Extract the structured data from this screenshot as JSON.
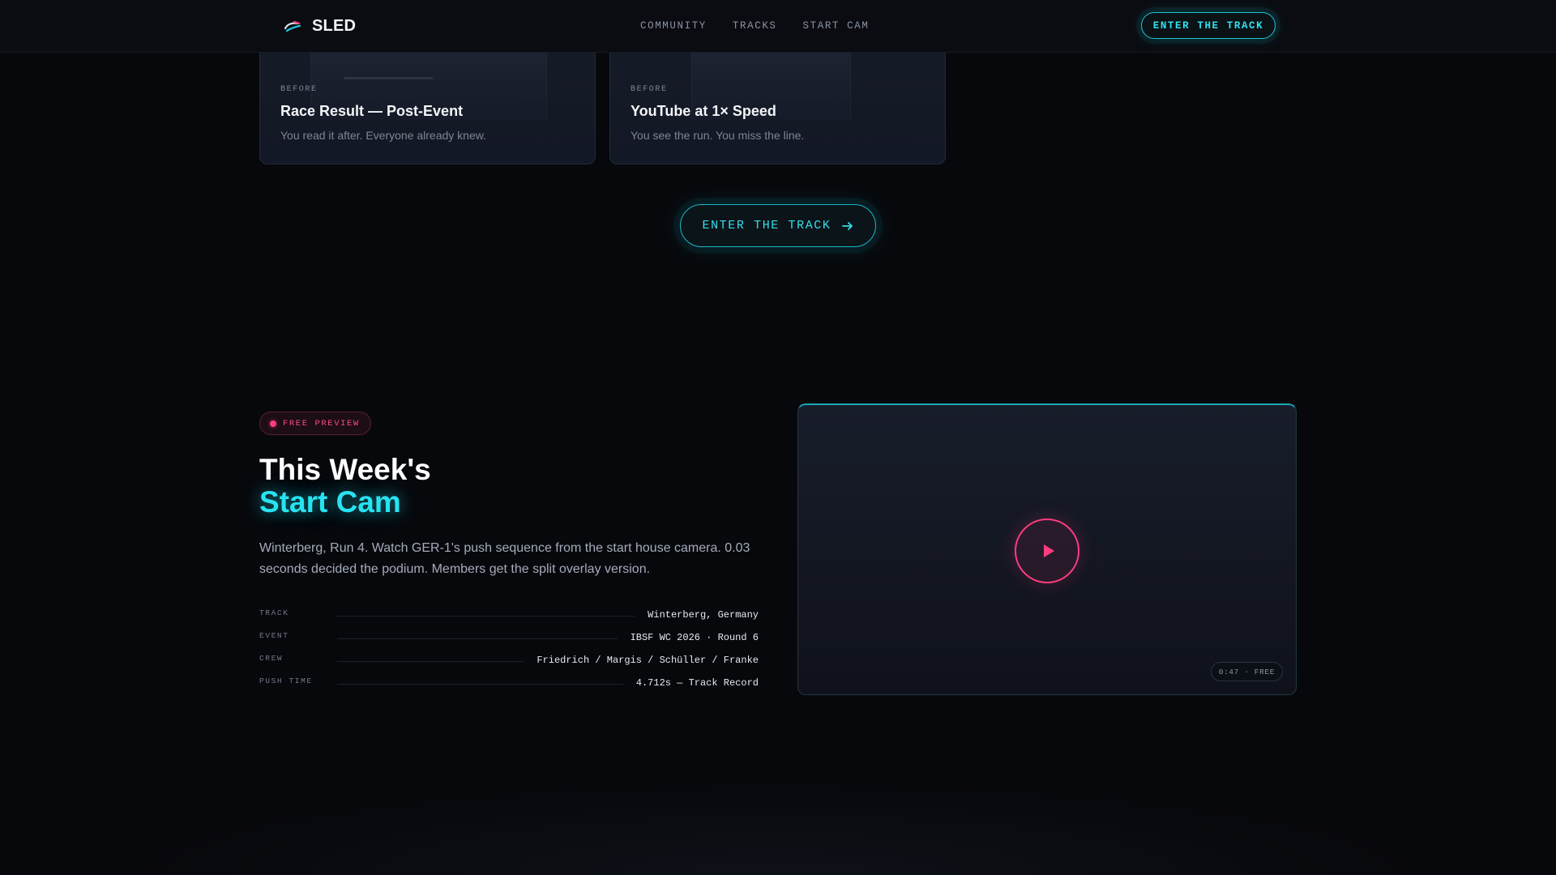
{
  "nav": {
    "brand": "SLED",
    "links": [
      "COMMUNITY",
      "TRACKS",
      "START CAM"
    ],
    "cta_label": "ENTER THE TRACK"
  },
  "cards": [
    {
      "eyebrow": "BEFORE",
      "title": "Race Result — Post-Event",
      "description": "You read it after. Everyone already knew."
    },
    {
      "eyebrow": "BEFORE",
      "title": "YouTube at 1× Speed",
      "description": "You see the run. You miss the line."
    }
  ],
  "center_cta": {
    "label": "ENTER THE TRACK",
    "icon": "arrow-right-icon"
  },
  "preview": {
    "badge": "FREE PREVIEW",
    "heading_line1": "This Week's",
    "heading_line2": "Start Cam",
    "description": "Winterberg, Run 4. Watch GER-1's push sequence from the start house camera. 0.03 seconds decided the podium. Members get the split overlay version.",
    "specs": [
      {
        "label": "TRACK",
        "value": "Winterberg, Germany"
      },
      {
        "label": "EVENT",
        "value": "IBSF WC 2026 · Round 6"
      },
      {
        "label": "CREW",
        "value": "Friedrich / Margis / Schüller / Franke"
      },
      {
        "label": "PUSH TIME",
        "value": "4.712s — Track Record"
      }
    ],
    "video": {
      "duration_label": "0:47 · FREE",
      "play_icon": "play-icon"
    }
  },
  "colors": {
    "background": "#07080c",
    "accent_cyan": "#27e3f2",
    "accent_pink": "#ff3d7f",
    "card_bg": "#161b27"
  }
}
